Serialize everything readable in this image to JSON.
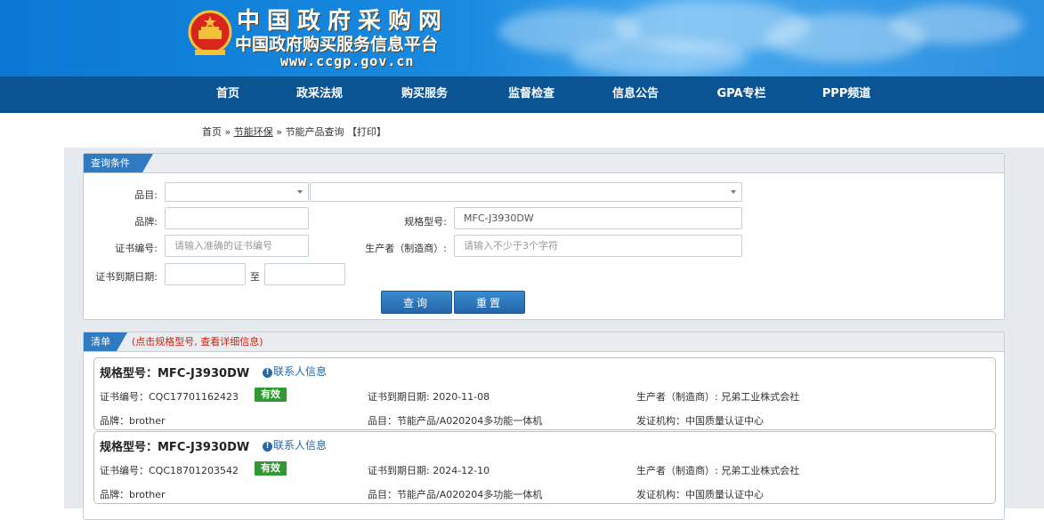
{
  "header": {
    "title": "中国政府采购网",
    "subtitle": "中国政府购买服务信息平台",
    "url": "www.ccgp.gov.cn",
    "colors": {
      "banner": "#1a8ae0",
      "nav": "#0a5494",
      "emblem": "#d8261c"
    }
  },
  "nav": {
    "items": [
      "首页",
      "政采法规",
      "购买服务",
      "监督检查",
      "信息公告",
      "GPA专栏",
      "PPP频道"
    ]
  },
  "breadcrumb": {
    "home": "首页",
    "sep1": " » ",
    "section": "节能环保",
    "sep2": " » ",
    "current": "节能产品查询",
    "print": "【打印】"
  },
  "query": {
    "title": "查询条件",
    "category_label": "品目:",
    "brand_label": "品牌:",
    "brand_value": "",
    "model_label": "规格型号:",
    "model_value": "MFC-J3930DW",
    "cert_label": "证书编号:",
    "cert_placeholder": "请输入准确的证书编号",
    "maker_label": "生产者（制造商）:",
    "maker_placeholder": "请输入不少于3个字符",
    "expire_label": "证书到期日期:",
    "to_label": "至",
    "search_button": "查询",
    "reset_button": "重置"
  },
  "list": {
    "title": "清单",
    "hint": "(点击规格型号, 查看详细信息)",
    "hint_color": "#d81e06",
    "contact_label": "联系人信息",
    "items": [
      {
        "model": "规格型号：MFC-J3930DW",
        "cert": "证书编号：CQC17701162423",
        "status": "有效",
        "expire": "证书到期日期: 2020-11-08",
        "maker": "生产者（制造商）: 兄弟工业株式会社",
        "brand": "品牌：brother",
        "category": "品目：节能产品/A020204多功能一体机",
        "issuer": "发证机构：中国质量认证中心"
      },
      {
        "model": "规格型号：MFC-J3930DW",
        "cert": "证书编号：CQC18701203542",
        "status": "有效",
        "expire": "证书到期日期: 2024-12-10",
        "maker": "生产者（制造商）: 兄弟工业株式会社",
        "brand": "品牌：brother",
        "category": "品目：节能产品/A020204多功能一体机",
        "issuer": "发证机构：中国质量认证中心"
      }
    ]
  }
}
